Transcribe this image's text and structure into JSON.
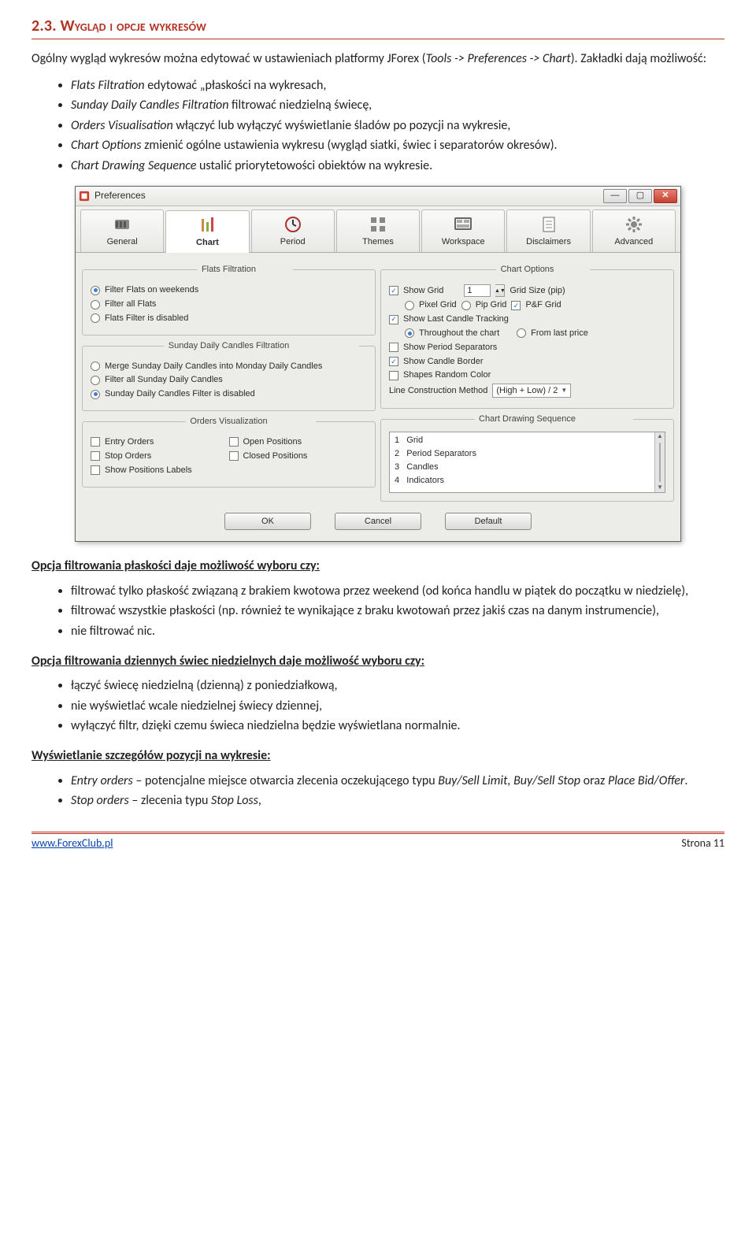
{
  "section_title": "2.3. Wygląd i opcje wykresów",
  "intro_pre": "Ogólny wygląd wykresów można edytować w ustawieniach platformy JForex (",
  "intro_italic": "Tools -> Preferences -> Chart",
  "intro_post": "). Zakładki dają możliwość:",
  "top_bullets": [
    {
      "it": "Flats Filtration",
      "txt": " edytować „płaskości na wykresach,"
    },
    {
      "it": "Sunday Daily Candles Filtration",
      "txt": " filtrować niedzielną świecę,"
    },
    {
      "it": "Orders Visualisation",
      "txt": " włączyć lub wyłączyć wyświetlanie śladów po pozycji na wykresie,"
    },
    {
      "it": "Chart Options",
      "txt": " zmienić ogólne ustawienia wykresu (wygląd siatki, świec i separatorów okresów)."
    },
    {
      "it": "Chart Drawing Sequence",
      "txt": " ustalić priorytetowości obiektów na wykresie."
    }
  ],
  "prefs": {
    "title": "Preferences",
    "tabs": [
      "General",
      "Chart",
      "Period",
      "Themes",
      "Workspace",
      "Disclaimers",
      "Advanced"
    ],
    "active_tab_index": 1,
    "groups": {
      "flats_filtration": {
        "legend": "Flats Filtration",
        "opts": [
          "Filter Flats on weekends",
          "Filter all Flats",
          "Flats Filter is disabled"
        ],
        "selected_index": 0
      },
      "sunday_candles": {
        "legend": "Sunday Daily Candles Filtration",
        "opts": [
          "Merge Sunday Daily Candles into Monday Daily Candles",
          "Filter all Sunday Daily Candles",
          "Sunday Daily Candles Filter is disabled"
        ],
        "selected_index": 2
      },
      "orders_vis": {
        "legend": "Orders Visualization",
        "left": [
          "Entry Orders",
          "Stop Orders",
          "Show Positions Labels"
        ],
        "right": [
          "Open Positions",
          "Closed Positions"
        ]
      },
      "chart_options": {
        "legend": "Chart Options",
        "show_grid": "Show Grid",
        "grid_value": "1",
        "grid_size_label": "Grid Size (pip)",
        "grid_types": [
          "Pixel Grid",
          "Pip Grid",
          "P&F Grid"
        ],
        "grid_type_selected": [
          false,
          false,
          true
        ],
        "show_last_candle": "Show Last Candle Tracking",
        "throughout": "Throughout the chart",
        "from_last": "From last price",
        "throughout_selected": true,
        "show_period_sep": "Show Period Separators",
        "show_candle_border": "Show Candle Border",
        "shapes_random": "Shapes Random Color",
        "line_method_label": "Line Construction Method",
        "line_method_value": "(High + Low) / 2"
      },
      "drawing_seq": {
        "legend": "Chart Drawing Sequence",
        "items": [
          "Grid",
          "Period Separators",
          "Candles",
          "Indicators"
        ]
      }
    },
    "buttons": {
      "ok": "OK",
      "cancel": "Cancel",
      "default": "Default"
    }
  },
  "sub1": "Opcja filtrowania płaskości daje możliwość wyboru czy:",
  "sub1_bullets": [
    "filtrować tylko płaskość związaną z brakiem kwotowa przez weekend (od końca handlu w piątek do początku w niedzielę),",
    "filtrować wszystkie płaskości (np. również te wynikające z braku kwotowań przez jakiś czas na danym instrumencie),",
    "nie filtrować nic."
  ],
  "sub2": "Opcja filtrowania dziennych świec niedzielnych daje możliwość wyboru czy:",
  "sub2_bullets": [
    "łączyć świecę niedzielną (dzienną) z poniedziałkową,",
    "nie wyświetlać wcale niedzielnej świecy dziennej,",
    "wyłączyć filtr, dzięki czemu świeca niedzielna będzie wyświetlana normalnie."
  ],
  "sub3": "Wyświetlanie szczegółów pozycji na wykresie:",
  "sub3_bullets": [
    {
      "it": "Entry orders",
      "txt": " – potencjalne miejsce otwarcia zlecenia oczekującego typu ",
      "it2": "Buy/Sell Limit, Buy/Sell Stop",
      "txt2": " oraz ",
      "it3": "Place Bid/Offer",
      "txt3": "."
    },
    {
      "it": "Stop orders",
      "txt": " – zlecenia typu ",
      "it2": "Stop Loss",
      "txt2": ","
    }
  ],
  "footer": {
    "url": "www.ForexClub.pl",
    "page": "Strona 11"
  }
}
